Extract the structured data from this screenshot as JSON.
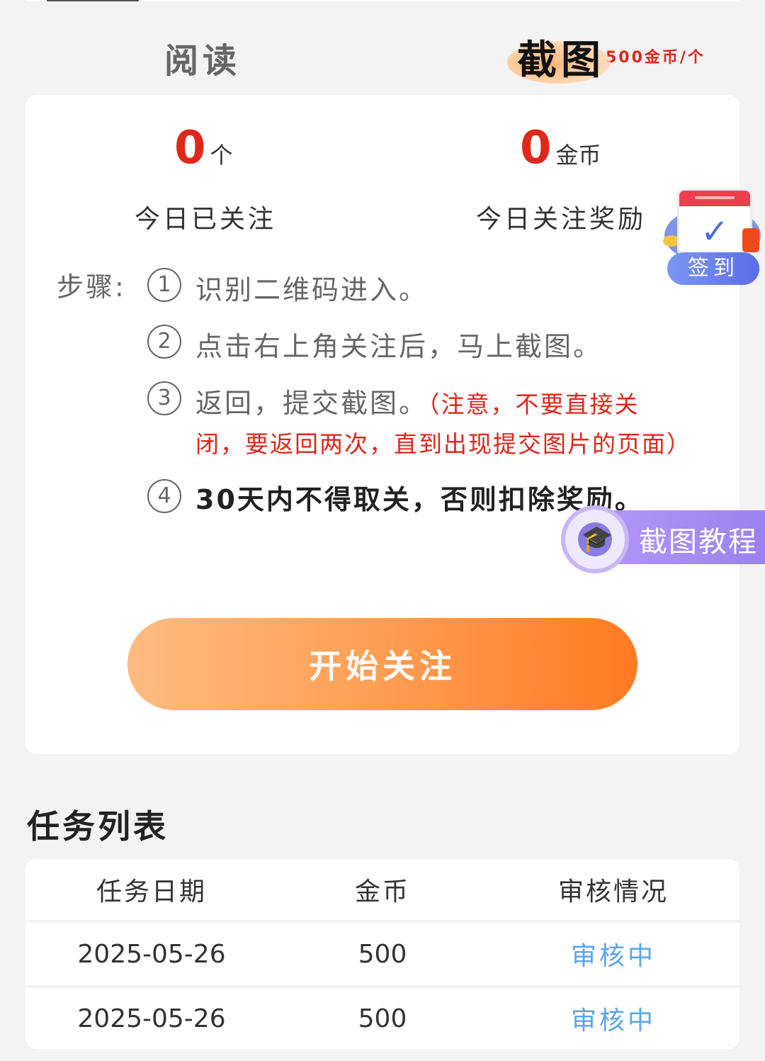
{
  "tabs": {
    "read": "阅读",
    "screenshot": "截图",
    "screenshot_price": "500金币/个"
  },
  "stats": {
    "followed_count": "0",
    "followed_unit": "个",
    "followed_label": "今日已关注",
    "reward_amount": "0",
    "reward_unit": "金币",
    "reward_label": "今日关注奖励"
  },
  "steps": {
    "label": "步骤:",
    "items": [
      {
        "num": "1",
        "text": "识别二维码进入。"
      },
      {
        "num": "2",
        "text": "点击右上角关注后，马上截图。"
      },
      {
        "num": "3",
        "text": "返回，提交截图。",
        "warning_line1": "（注意，不要直接关",
        "warning_line2": "闭，要返回两次，直到出现提交图片的页面）"
      },
      {
        "num": "4",
        "text": "30天内不得取关，否则扣除奖励。"
      }
    ]
  },
  "start_button": "开始关注",
  "signin": {
    "label": "签到",
    "icon": "calendar-check-icon"
  },
  "tutorial": {
    "label": "截图教程",
    "icon": "graduation-cap-icon"
  },
  "task_list": {
    "title": "任务列表",
    "columns": [
      "任务日期",
      "金币",
      "审核情况"
    ],
    "rows": [
      {
        "date": "2025-05-26",
        "coins": "500",
        "status": "审核中"
      },
      {
        "date": "2025-05-26",
        "coins": "500",
        "status": "审核中"
      }
    ]
  },
  "colors": {
    "accent_red": "#e0281a",
    "button_orange": "#ff7a22",
    "status_blue": "#5aa6ee",
    "signin_blue": "#5b6cea",
    "tutorial_purple": "#9a83ef"
  }
}
